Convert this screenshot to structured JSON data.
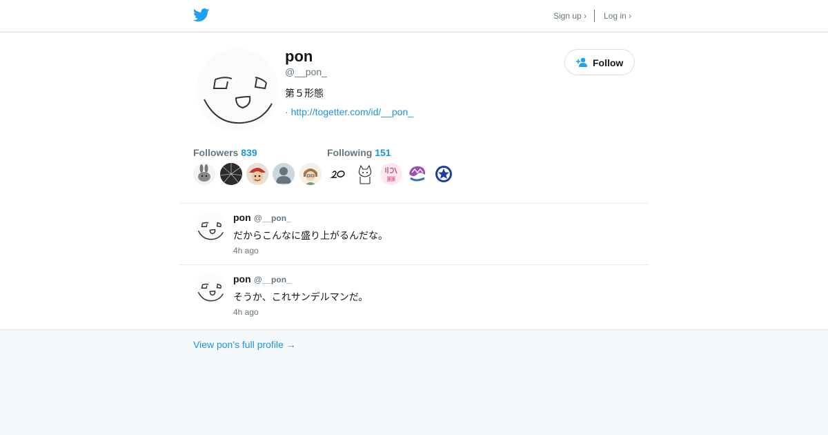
{
  "header": {
    "logo_icon": "twitter-bird-icon",
    "signup_label": "Sign up ›",
    "login_label": "Log in ›",
    "brand_color": "#1da1f2"
  },
  "profile": {
    "name": "pon",
    "handle": "@__pon_",
    "bio": "第５形態",
    "url_prefix": "·",
    "url": "http://togetter.com/id/__pon_",
    "follow_label": "Follow",
    "followers_label": "Followers",
    "followers_count": "839",
    "following_label": "Following",
    "following_count": "151"
  },
  "tweets": [
    {
      "name": "pon",
      "handle": "@__pon_",
      "text": "だからこんなに盛り上がるんだな。",
      "time": "4h ago"
    },
    {
      "name": "pon",
      "handle": "@__pon_",
      "text": "そうか、これサンデルマンだ。",
      "time": "4h ago"
    }
  ],
  "footer": {
    "full_profile_link": "View pon's full profile →"
  },
  "colors": {
    "link": "#1b95e0",
    "muted": "#66757f",
    "text": "#14171a",
    "footer_bg": "#f5f8fa"
  }
}
